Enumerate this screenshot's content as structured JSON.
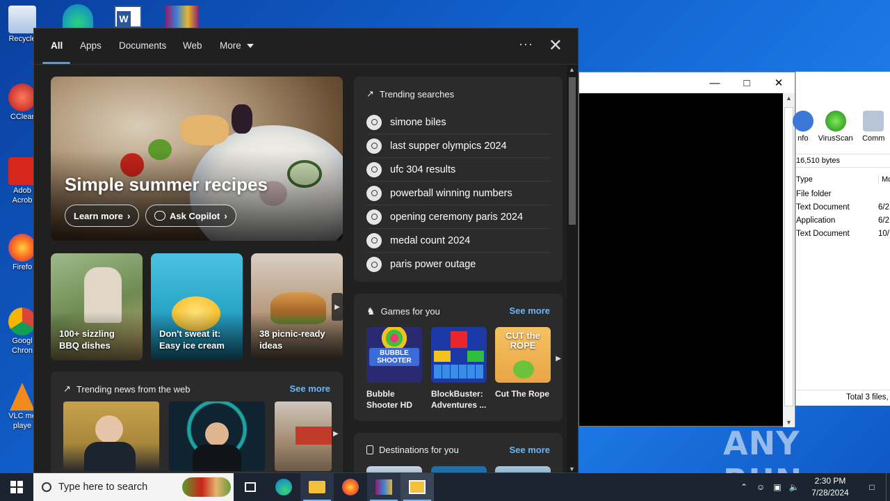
{
  "desktop": {
    "icons": [
      {
        "label": "Recycle",
        "color": "#d6e4f5"
      },
      {
        "label": "CClear",
        "color": "#c9393a"
      },
      {
        "label": "Adob Acrob",
        "color": "#d9261c"
      },
      {
        "label": "Firefo",
        "color": "#ff7b1c"
      },
      {
        "label": "Googl Chron",
        "color": "#e9e9e9"
      },
      {
        "label": "VLC me playe",
        "color": "#f08a1c"
      }
    ],
    "watermark": "ANY RUN"
  },
  "bg_window": {
    "minimize": "—",
    "maximize": "□",
    "close": "✕"
  },
  "explorer": {
    "ribbon": [
      {
        "label": "nfo",
        "icon": "info-icon",
        "color": "#3b78d8"
      },
      {
        "label": "VirusScan",
        "icon": "virusscan-icon",
        "color": "#2cb01e"
      },
      {
        "label": "Comm",
        "icon": "command-icon",
        "color": "#7d8fa8"
      }
    ],
    "size_text": "16,510 bytes",
    "columns": [
      "Type",
      "Mo"
    ],
    "rows": [
      {
        "type": "File folder",
        "mod": ""
      },
      {
        "type": "Text Document",
        "mod": "6/2"
      },
      {
        "type": "Application",
        "mod": "6/2"
      },
      {
        "type": "Text Document",
        "mod": "10/"
      }
    ],
    "status": "Total 3 files,"
  },
  "search_panel": {
    "tabs": [
      "All",
      "Apps",
      "Documents",
      "Web",
      "More"
    ],
    "more_icon": "ellipsis-icon",
    "hero": {
      "title": "Simple summer recipes",
      "learn_more": "Learn more",
      "ask_copilot": "Ask Copilot"
    },
    "recipe_cards": [
      {
        "caption": "100+ sizzling BBQ dishes",
        "bg": "#6f8b52"
      },
      {
        "caption": "Don't sweat it: Easy ice cream",
        "bg": "#2aa7c9"
      },
      {
        "caption": "38 picnic-ready ideas",
        "bg": "#b89a7c"
      }
    ],
    "trending": {
      "title": "Trending searches",
      "items": [
        "simone biles",
        "last supper olympics 2024",
        "ufc 304 results",
        "powerball winning numbers",
        "opening ceremony paris 2024",
        "medal count 2024",
        "paris power outage"
      ]
    },
    "games": {
      "title": "Games for you",
      "see_more": "See more",
      "items": [
        {
          "label": "Bubble Shooter HD",
          "thumb_text": "BUBBLE SHOOTER",
          "bg": "#2a2a72"
        },
        {
          "label": "BlockBuster: Adventures ...",
          "thumb_text": "",
          "bg": "#1b3aa8"
        },
        {
          "label": "Cut The Rope",
          "thumb_text": "CUT the ROPE",
          "bg": "#e9a544"
        }
      ]
    },
    "news": {
      "title": "Trending news from the web",
      "see_more": "See more",
      "images": [
        {
          "bg": "#a8883c"
        },
        {
          "bg": "#0f2430"
        },
        {
          "bg": "#a2886e"
        }
      ]
    },
    "destinations": {
      "title": "Destinations for you",
      "see_more": "See more"
    }
  },
  "taskbar": {
    "search_placeholder": "Type here to search",
    "time": "2:30 PM",
    "date": "7/28/2024"
  }
}
